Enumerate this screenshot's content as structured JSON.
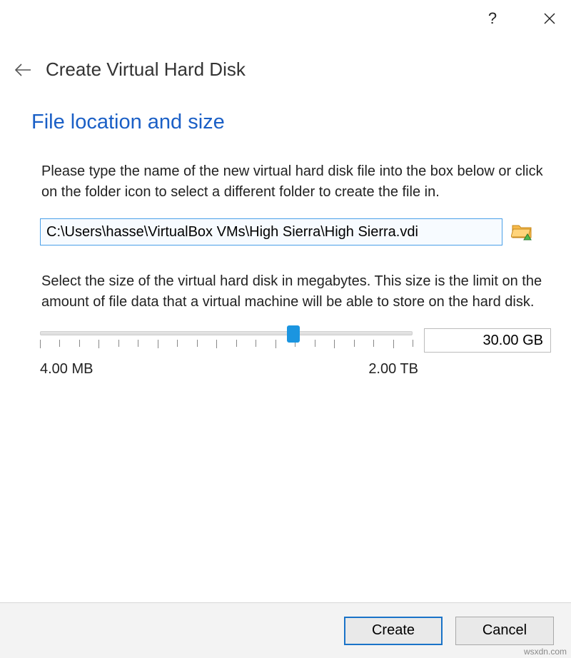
{
  "wizard": {
    "title": "Create Virtual Hard Disk"
  },
  "section": {
    "title": "File location and size",
    "instruction1": "Please type the name of the new virtual hard disk file into the box below or click on the folder icon to select a different folder to create the file in.",
    "instruction2": "Select the size of the virtual hard disk in megabytes. This size is the limit on the amount of file data that a virtual machine will be able to store on the hard disk."
  },
  "path": {
    "value": "C:\\Users\\hasse\\VirtualBox VMs\\High Sierra\\High Sierra.vdi"
  },
  "slider": {
    "min_label": "4.00 MB",
    "max_label": "2.00 TB",
    "value_display": "30.00 GB",
    "position_percent": 67
  },
  "buttons": {
    "create": "Create",
    "cancel": "Cancel"
  },
  "watermark": "wsxdn.com"
}
